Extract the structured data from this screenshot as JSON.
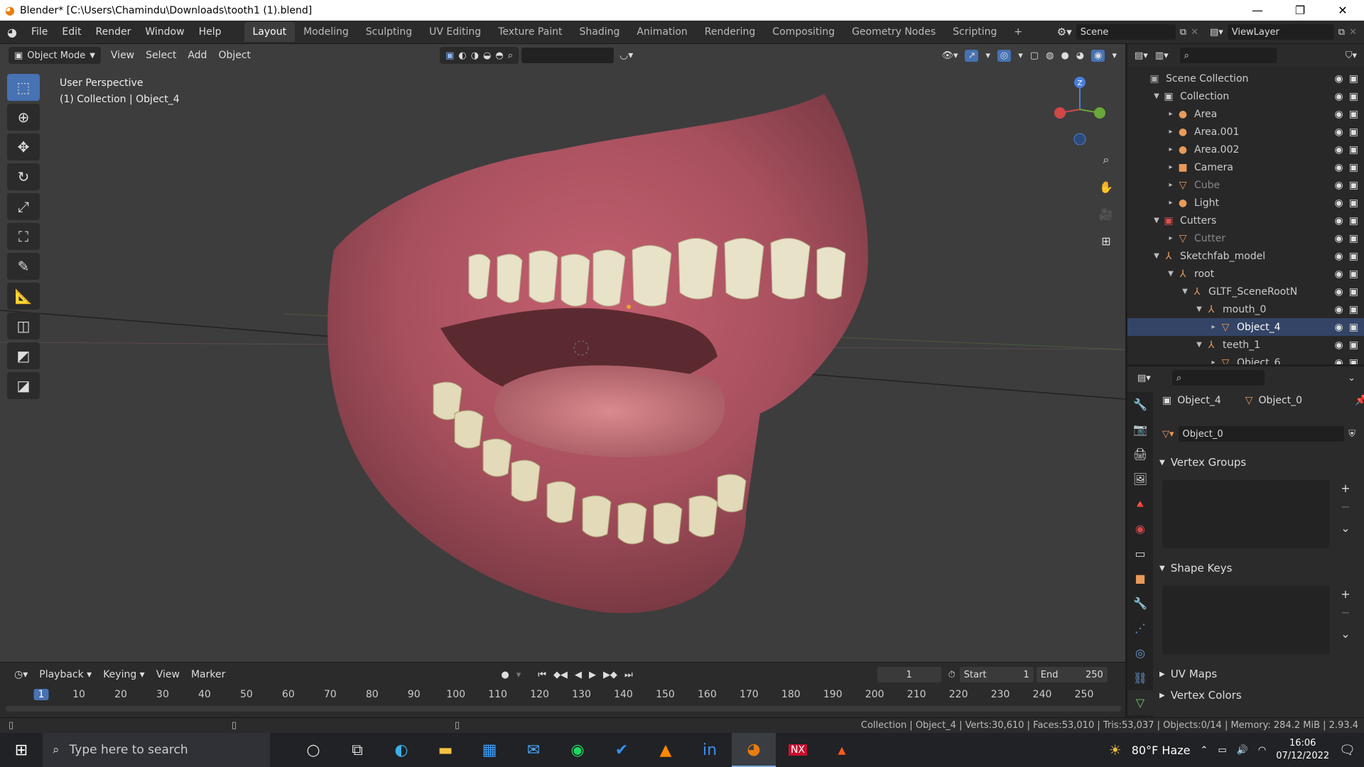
{
  "window": {
    "title": "Blender* [C:\\Users\\Chamindu\\Downloads\\tooth1 (1).blend]",
    "min": "—",
    "max": "❐",
    "close": "✕"
  },
  "menus": [
    "File",
    "Edit",
    "Render",
    "Window",
    "Help"
  ],
  "workspaces": [
    "Layout",
    "Modeling",
    "Sculpting",
    "UV Editing",
    "Texture Paint",
    "Shading",
    "Animation",
    "Rendering",
    "Compositing",
    "Geometry Nodes",
    "Scripting"
  ],
  "scene": "Scene",
  "view_layer": "ViewLayer",
  "viewport": {
    "mode": "Object Mode",
    "menus": [
      "View",
      "Select",
      "Add",
      "Object"
    ],
    "perspective": "User Perspective",
    "context": "(1) Collection | Object_4"
  },
  "outliner": {
    "rows": [
      {
        "label": "Scene Collection",
        "indent": 0,
        "icon": "▣",
        "arrow": "",
        "color": "#ccc",
        "icon_color": "#aaa"
      },
      {
        "label": "Collection",
        "indent": 1,
        "icon": "▣",
        "arrow": "▼",
        "color": "#ccc",
        "icon_color": "#ccc"
      },
      {
        "label": "Area",
        "indent": 2,
        "icon": "●",
        "arrow": "▸",
        "color": "#ccc",
        "icon_color": "#e89a5b"
      },
      {
        "label": "Area.001",
        "indent": 2,
        "icon": "●",
        "arrow": "▸",
        "color": "#ccc",
        "icon_color": "#e89a5b"
      },
      {
        "label": "Area.002",
        "indent": 2,
        "icon": "●",
        "arrow": "▸",
        "color": "#ccc",
        "icon_color": "#e89a5b"
      },
      {
        "label": "Camera",
        "indent": 2,
        "icon": "■",
        "arrow": "▸",
        "color": "#ccc",
        "icon_color": "#e89a5b"
      },
      {
        "label": "Cube",
        "indent": 2,
        "icon": "▽",
        "arrow": "▸",
        "color": "#888",
        "icon_color": "#e89a5b"
      },
      {
        "label": "Light",
        "indent": 2,
        "icon": "●",
        "arrow": "▸",
        "color": "#ccc",
        "icon_color": "#e89a5b"
      },
      {
        "label": "Cutters",
        "indent": 1,
        "icon": "▣",
        "arrow": "▼",
        "color": "#ccc",
        "icon_color": "#e05050"
      },
      {
        "label": "Cutter",
        "indent": 2,
        "icon": "▽",
        "arrow": "▸",
        "color": "#888",
        "icon_color": "#e89a5b"
      },
      {
        "label": "Sketchfab_model",
        "indent": 1,
        "icon": "⅄",
        "arrow": "▼",
        "color": "#ccc",
        "icon_color": "#e89a5b"
      },
      {
        "label": "root",
        "indent": 2,
        "icon": "⅄",
        "arrow": "▼",
        "color": "#ccc",
        "icon_color": "#e89a5b"
      },
      {
        "label": "GLTF_SceneRootN",
        "indent": 3,
        "icon": "⅄",
        "arrow": "▼",
        "color": "#ccc",
        "icon_color": "#e89a5b"
      },
      {
        "label": "mouth_0",
        "indent": 4,
        "icon": "⅄",
        "arrow": "▼",
        "color": "#ccc",
        "icon_color": "#e89a5b"
      },
      {
        "label": "Object_4",
        "indent": 5,
        "icon": "▽",
        "arrow": "▸",
        "color": "#fff",
        "icon_color": "#e89a5b"
      },
      {
        "label": "teeth_1",
        "indent": 4,
        "icon": "⅄",
        "arrow": "▼",
        "color": "#ccc",
        "icon_color": "#e89a5b"
      },
      {
        "label": "Object_6",
        "indent": 5,
        "icon": "▽",
        "arrow": "▸",
        "color": "#ccc",
        "icon_color": "#e89a5b"
      }
    ]
  },
  "properties": {
    "object": "Object_4",
    "mesh": "Object_0",
    "mesh_field": "Object_0",
    "panels": {
      "vertex_groups": "Vertex Groups",
      "shape_keys": "Shape Keys",
      "uv_maps": "UV Maps",
      "vertex_colors": "Vertex Colors"
    }
  },
  "timeline": {
    "menus": [
      "Playback",
      "Keying",
      "View",
      "Marker"
    ],
    "current_frame": "1",
    "start_label": "Start",
    "start": "1",
    "end_label": "End",
    "end": "250",
    "ticks": [
      "1",
      "10",
      "20",
      "30",
      "40",
      "50",
      "60",
      "70",
      "80",
      "90",
      "100",
      "110",
      "120",
      "130",
      "140",
      "150",
      "160",
      "170",
      "180",
      "190",
      "200",
      "210",
      "220",
      "230",
      "240",
      "250"
    ]
  },
  "status": "Collection | Object_4 | Verts:30,610 | Faces:53,010 | Tris:53,037 | Objects:0/14 | Memory: 284.2 MiB | 2.93.4",
  "taskbar": {
    "search_placeholder": "Type here to search",
    "weather": "80°F  Haze",
    "time": "16:06",
    "date": "07/12/2022"
  }
}
